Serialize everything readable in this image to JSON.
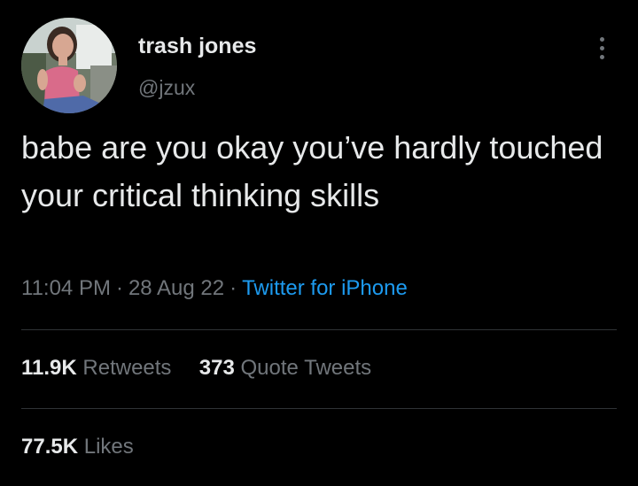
{
  "author": {
    "name": "trash jones",
    "handle": "@jzux"
  },
  "tweet": {
    "text": "babe are you okay you’ve hardly touched your critical thinking skills",
    "time": "11:04 PM",
    "date": "28 Aug 22",
    "separator": "·",
    "source": "Twitter for iPhone"
  },
  "stats": {
    "retweets_count": "11.9K",
    "retweets_label": "Retweets",
    "quote_count": "373",
    "quote_label": "Quote Tweets",
    "likes_count": "77.5K",
    "likes_label": "Likes"
  },
  "icons": {
    "more": "more-options-icon",
    "avatar": "avatar"
  },
  "colors": {
    "background": "#000000",
    "primary_text": "#e7e9ea",
    "secondary_text": "#71767b",
    "link": "#1d9bf0",
    "divider": "#2f3336"
  }
}
